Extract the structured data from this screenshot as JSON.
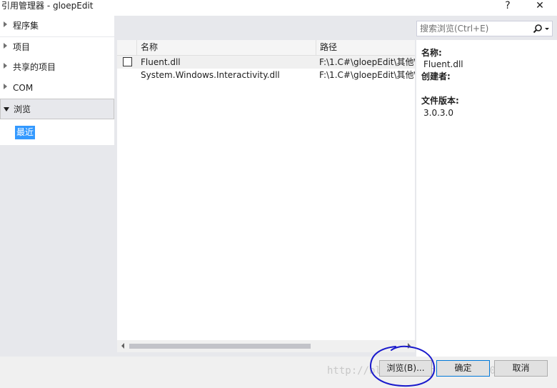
{
  "window": {
    "title": "引用管理器 - gloepEdit",
    "help_label": "?",
    "close_label": "✕"
  },
  "sidebar": {
    "items": [
      {
        "label": "程序集"
      },
      {
        "label": "项目"
      },
      {
        "label": "共享的项目"
      },
      {
        "label": "COM"
      },
      {
        "label": "浏览"
      }
    ],
    "sub_items": [
      {
        "label": "最近"
      }
    ]
  },
  "search": {
    "placeholder": "搜索浏览(Ctrl+E)",
    "icon": "search-icon"
  },
  "list": {
    "columns": [
      "名称",
      "路径"
    ],
    "rows": [
      {
        "name": "Fluent.dll",
        "path": "F:\\1.C#\\gloepEdit\\其他\\",
        "checked": false
      },
      {
        "name": "System.Windows.Interactivity.dll",
        "path": "F:\\1.C#\\gloepEdit\\其他\\"
      }
    ]
  },
  "details": {
    "name_label": "名称:",
    "name_value": "Fluent.dll",
    "creator_label": "创建者:",
    "version_label": "文件版本:",
    "version_value": "3.0.3.0"
  },
  "footer": {
    "browse_label": "浏览(B)...",
    "ok_label": "确定",
    "cancel_label": "取消",
    "watermark": "http://blog.csdn.net/u011750515"
  },
  "colors": {
    "accent": "#3399ff",
    "panel_bg": "#e7e8ec",
    "annotation": "#1a1acc"
  }
}
